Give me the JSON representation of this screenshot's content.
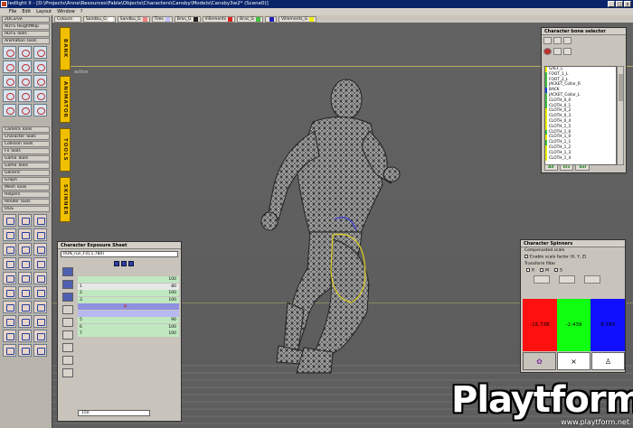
{
  "window": {
    "title": "ledlight II - [D:\\Projects\\Anne\\Resources\\Fable\\Objects\\Characters\\Cansby\\Models\\Cansby3w2* (Scene0)]",
    "controls": [
      "_",
      "□",
      "x"
    ]
  },
  "menu": [
    "File",
    "Edit",
    "Layout",
    "Window",
    "?"
  ],
  "colorbar": [
    {
      "label": "Colours",
      "color": "#e8e8e8"
    },
    {
      "label": "Sandbu_G",
      "color": "#ffffff"
    },
    {
      "label": "Sandbu_G",
      "color": "#f08080"
    },
    {
      "label": "Tiles",
      "color": "#c0c0ff"
    },
    {
      "label": "Bras_G",
      "color": "#202020"
    },
    {
      "label": "Villements",
      "color": "#e02020"
    },
    {
      "label": "Bras_G",
      "color": "#40c040"
    },
    {
      "label": "",
      "color": "#2020c0"
    },
    {
      "label": "Villements_G",
      "color": "#f0f000"
    }
  ],
  "left_panel": {
    "top_items": [
      "2DCurve",
      "ADTS HeightMap",
      "ADTS Tools",
      "Animation Tools"
    ],
    "mid_items": [
      "Camera Tools",
      "Character Tools",
      "Collision Tools",
      "Fx Tools",
      "Game Tools",
      "Game Tools",
      "Generic",
      "Graph",
      "Mesh Tools",
      "Helpers",
      "Render Tools",
      "OGS"
    ]
  },
  "side_tabs": [
    "BANK",
    "ANIMATOR",
    "TOOLS",
    "SKINNER"
  ],
  "viewport": {
    "label": "active"
  },
  "bone_selector": {
    "title": "Character bone selector",
    "bones": [
      {
        "name": "GALF_L",
        "color": "#f0f000"
      },
      {
        "name": "FOOT_1_L",
        "color": "#40c040"
      },
      {
        "name": "FOOT_2_L",
        "color": "#40c040"
      },
      {
        "name": "JACKET_Collar_R",
        "color": "#40c040"
      },
      {
        "name": "BACK",
        "color": "#2040e0"
      },
      {
        "name": "JACKET_Collar_L",
        "color": "#40c040"
      },
      {
        "name": "CLOTH_0_0",
        "color": "#40c040"
      },
      {
        "name": "CLOTH_0_1",
        "color": "#40c040"
      },
      {
        "name": "CLOTH_0_2",
        "color": "#f0f000"
      },
      {
        "name": "CLOTH_0_3",
        "color": "#f0f000"
      },
      {
        "name": "CLOTH_0_4",
        "color": "#f0f000"
      },
      {
        "name": "CLOTH_1_5",
        "color": "#f0f000"
      },
      {
        "name": "CLOTH_1_6",
        "color": "#40c040"
      },
      {
        "name": "CLOTH_1_0",
        "color": "#f0f000"
      },
      {
        "name": "CLOTH_1_1",
        "color": "#40c040"
      },
      {
        "name": "CLOTH_1_2",
        "color": "#f0f000"
      },
      {
        "name": "CLOTH_1_3",
        "color": "#f0f000"
      },
      {
        "name": "CLOTH_1_4",
        "color": "#f0f000"
      }
    ],
    "buttons": [
      "All",
      "Inv",
      "Sel"
    ]
  },
  "exposure_sheet": {
    "title": "Character Exposure Sheet",
    "anim_name": "RUN_run_F(0,1,780)",
    "rows": [
      {
        "num": "",
        "value": "100",
        "color": "#c0e8c0"
      },
      {
        "num": "1",
        "value": "80",
        "color": "#e8e8e8"
      },
      {
        "num": "2",
        "value": "100",
        "color": "#c0e8c0"
      },
      {
        "num": "3",
        "value": "100",
        "color": "#c0e8c0"
      },
      {
        "num": "",
        "value": "",
        "color": "#9090e0"
      },
      {
        "num": "",
        "value": "",
        "color": "#b8b8f0"
      },
      {
        "num": "5",
        "value": "90",
        "color": "#c0e8c0"
      },
      {
        "num": "6",
        "value": "100",
        "color": "#c0e8c0"
      },
      {
        "num": "7",
        "value": "100",
        "color": "#c0e8c0"
      }
    ],
    "frame_field": "150"
  },
  "spinners": {
    "title": "Character Spinners",
    "compensated": "Compensated scale",
    "enable_scale": "Enable scale factor (X, Y, Z)",
    "transform_filter": "Transform filter",
    "filters": [
      "R",
      "M",
      "S"
    ],
    "values": [
      {
        "value": "-15.738",
        "color": "#ff1010"
      },
      {
        "value": "-2.439",
        "color": "#10ff10"
      },
      {
        "value": "8.789",
        "color": "#1010ff"
      }
    ],
    "bottom_close": "×"
  },
  "logo": {
    "brand": "Playtform",
    "url": "www.playtform.net"
  }
}
